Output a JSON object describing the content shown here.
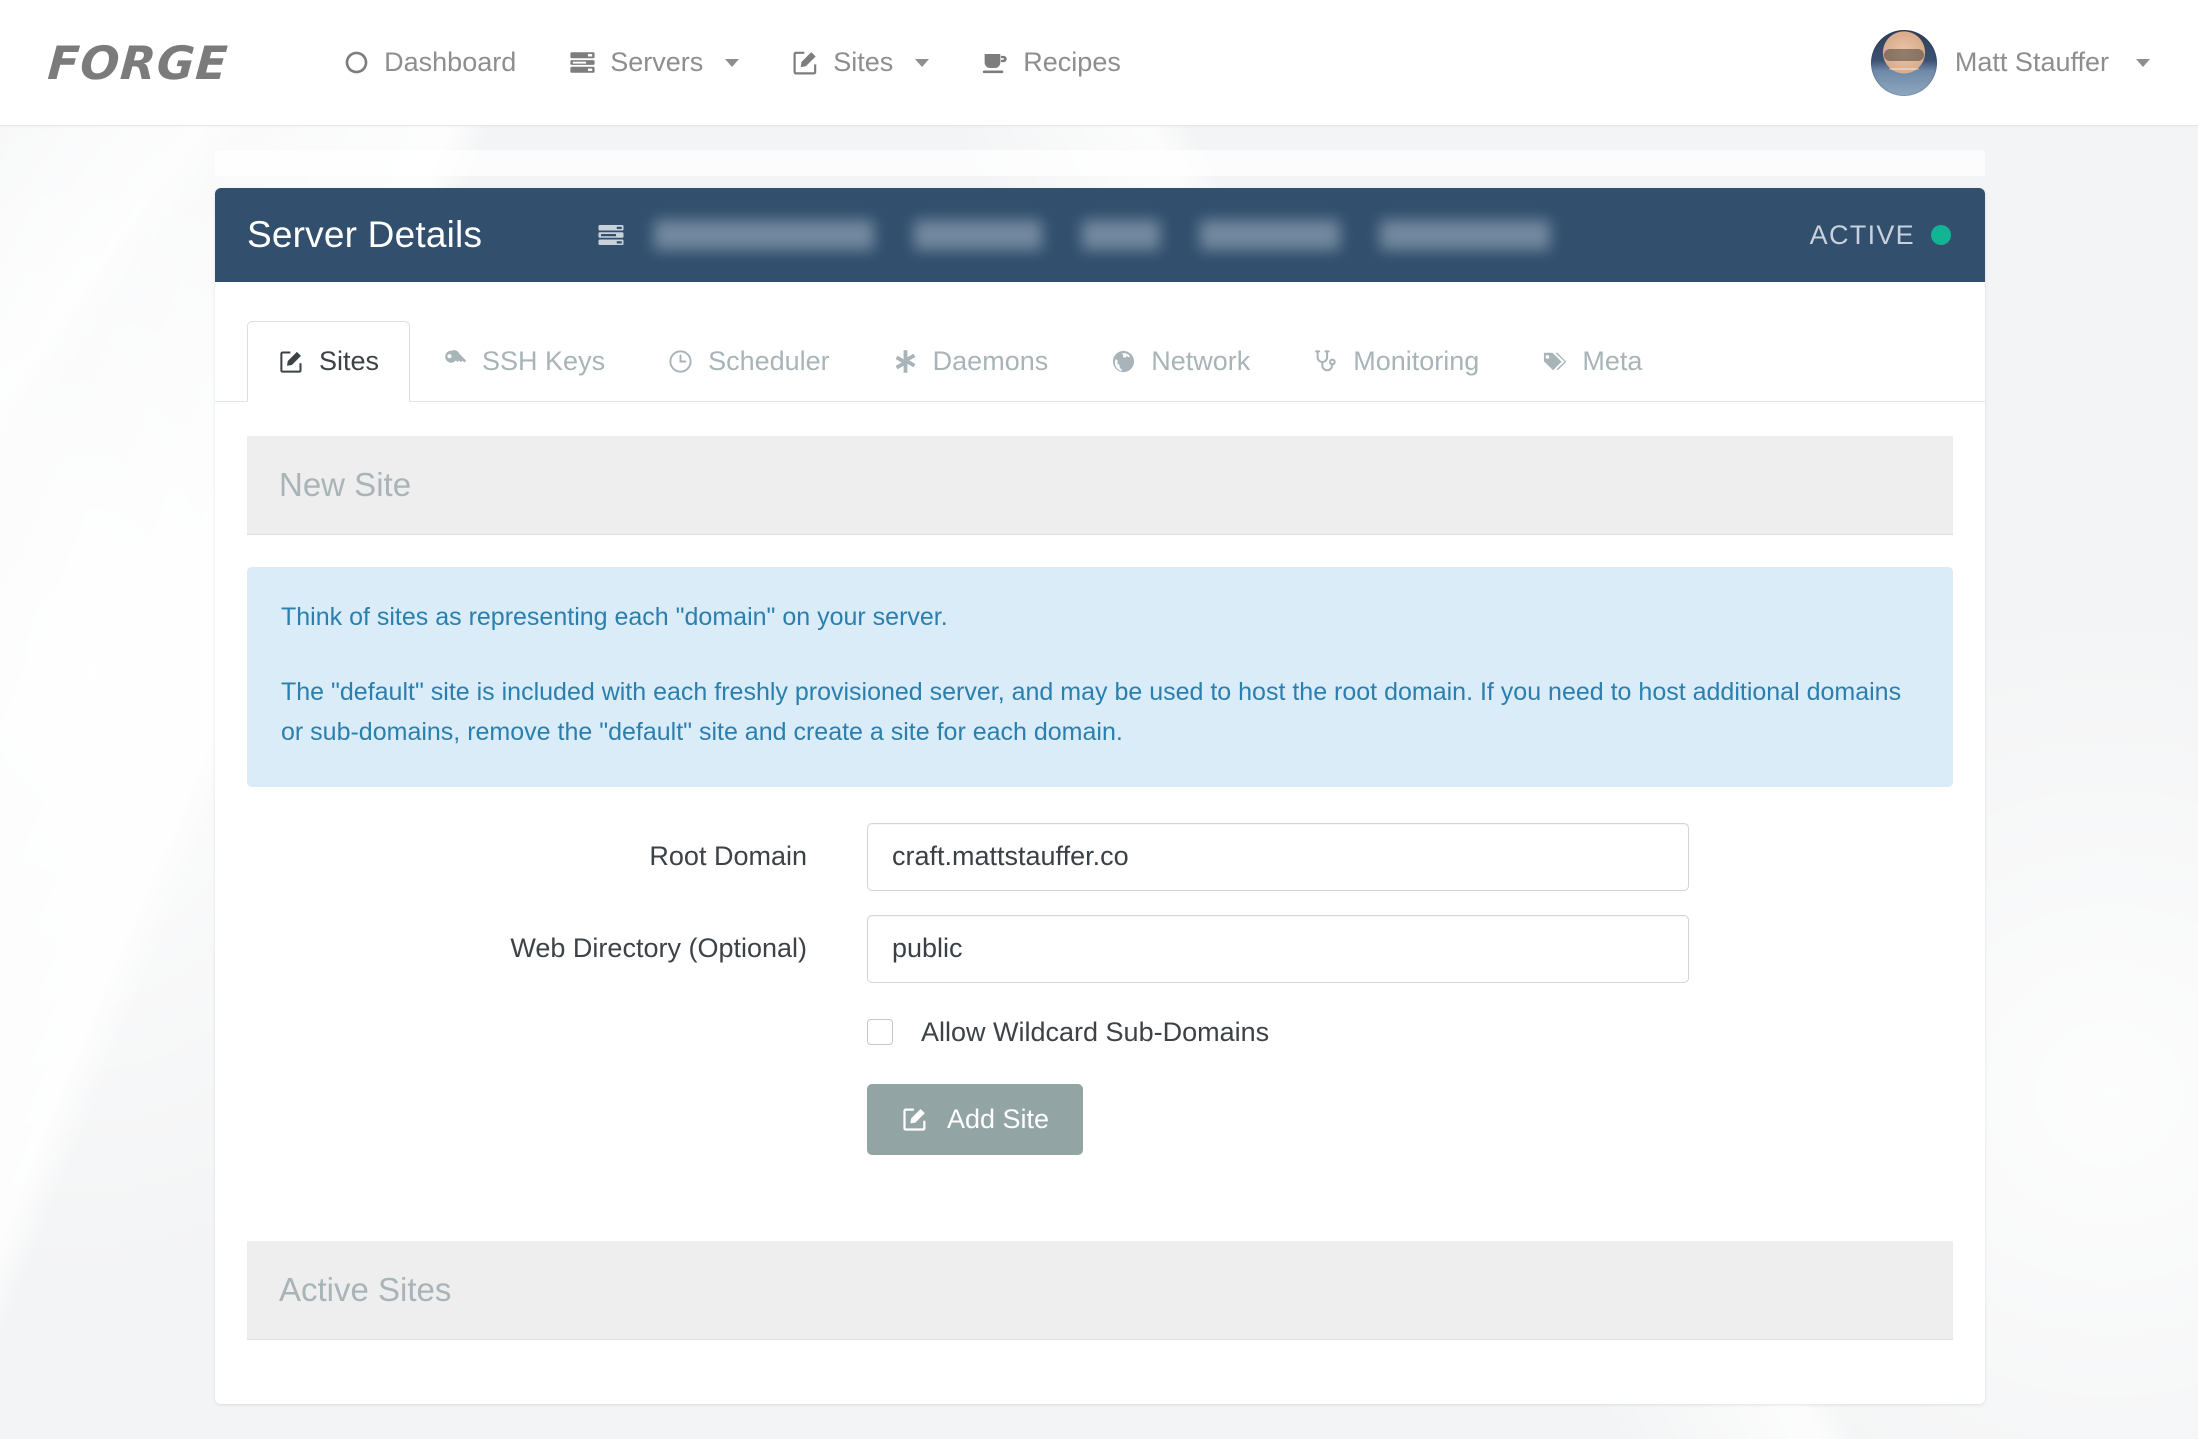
{
  "brand": {
    "name": "FORGE"
  },
  "nav": {
    "items": [
      {
        "label": "Dashboard",
        "icon": "dashboard-icon",
        "caret": false
      },
      {
        "label": "Servers",
        "icon": "servers-icon",
        "caret": true
      },
      {
        "label": "Sites",
        "icon": "sites-icon",
        "caret": true
      },
      {
        "label": "Recipes",
        "icon": "recipes-icon",
        "caret": false
      }
    ],
    "user": {
      "name": "Matt Stauffer",
      "avatar": "user-avatar",
      "caret": true
    }
  },
  "card": {
    "title": "Server Details",
    "server_icon": "server-stack-icon",
    "redacted_blocks": [
      220,
      128,
      78,
      140,
      170
    ],
    "status": {
      "label": "ACTIVE",
      "dot_color": "#13b494"
    }
  },
  "tabs": [
    {
      "label": "Sites",
      "icon": "pencil-square-icon",
      "active": true
    },
    {
      "label": "SSH Keys",
      "icon": "key-icon",
      "active": false
    },
    {
      "label": "Scheduler",
      "icon": "clock-icon",
      "active": false
    },
    {
      "label": "Daemons",
      "icon": "asterisk-icon",
      "active": false
    },
    {
      "label": "Network",
      "icon": "globe-icon",
      "active": false
    },
    {
      "label": "Monitoring",
      "icon": "stethoscope-icon",
      "active": false
    },
    {
      "label": "Meta",
      "icon": "tags-icon",
      "active": false
    }
  ],
  "new_site": {
    "heading": "New Site",
    "alert": {
      "paragraph1": "Think of sites as representing each \"domain\" on your server.",
      "paragraph2": "The \"default\" site is included with each freshly provisioned server, and may be used to host the root domain. If you need to host additional domains or sub-domains, remove the \"default\" site and create a site for each domain."
    },
    "fields": {
      "root_domain": {
        "label": "Root Domain",
        "value": "craft.mattstauffer.co",
        "placeholder": ""
      },
      "web_directory": {
        "label": "Web Directory (Optional)",
        "value": "public",
        "placeholder": ""
      }
    },
    "wildcard": {
      "label": "Allow Wildcard Sub-Domains",
      "checked": false
    },
    "submit": {
      "label": "Add Site",
      "icon": "pencil-square-icon",
      "color": "#93a4a4"
    }
  },
  "active_sites": {
    "heading": "Active Sites"
  },
  "colors": {
    "header_navy": "#32506e",
    "alert_bg": "#d9ecf7",
    "alert_text": "#2b7fae",
    "section_bg": "#eeeeee",
    "muted_text": "#a9b4b8",
    "accent_green": "#13b494"
  }
}
